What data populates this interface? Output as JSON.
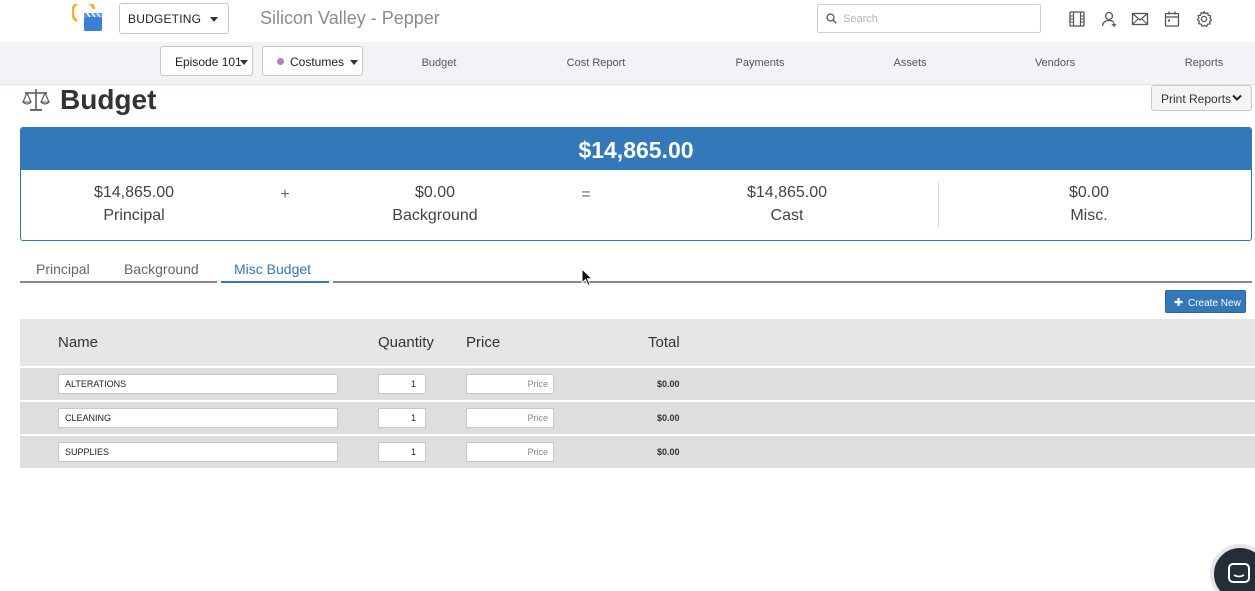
{
  "topbar": {
    "module_label": "BUDGETING",
    "project_title": "Silicon Valley - Pepper",
    "search_placeholder": "Search",
    "icons": [
      "film-icon",
      "add-user-icon",
      "mail-icon",
      "calendar-icon",
      "settings-icon"
    ]
  },
  "nav": {
    "episode_label": "Episode 101",
    "department_label": "Costumes",
    "department_color": "#b57fc8",
    "links": [
      "Budget",
      "Cost Report",
      "Payments",
      "Assets",
      "Vendors",
      "Reports"
    ]
  },
  "page": {
    "title": "Budget",
    "print_reports_label": "Print Reports"
  },
  "summary": {
    "grand_total": "$14,865.00",
    "principal": {
      "amount": "$14,865.00",
      "label": "Principal"
    },
    "plus_sign": "+",
    "background": {
      "amount": "$0.00",
      "label": "Background"
    },
    "equals_sign": "=",
    "cast": {
      "amount": "$14,865.00",
      "label": "Cast"
    },
    "misc": {
      "amount": "$0.00",
      "label": "Misc."
    },
    "accent_color": "#3378b8"
  },
  "tabs": [
    {
      "label": "Principal",
      "active": false
    },
    {
      "label": "Background",
      "active": false
    },
    {
      "label": "Misc Budget",
      "active": true
    }
  ],
  "create_new_label": "Create New",
  "table": {
    "columns": [
      "Name",
      "Quantity",
      "Price",
      "Total"
    ],
    "price_placeholder": "Price",
    "rows": [
      {
        "name": "ALTERATIONS",
        "quantity": "1",
        "price": "",
        "total": "$0.00"
      },
      {
        "name": "CLEANING",
        "quantity": "1",
        "price": "",
        "total": "$0.00"
      },
      {
        "name": "SUPPLIES",
        "quantity": "1",
        "price": "",
        "total": "$0.00"
      }
    ]
  }
}
